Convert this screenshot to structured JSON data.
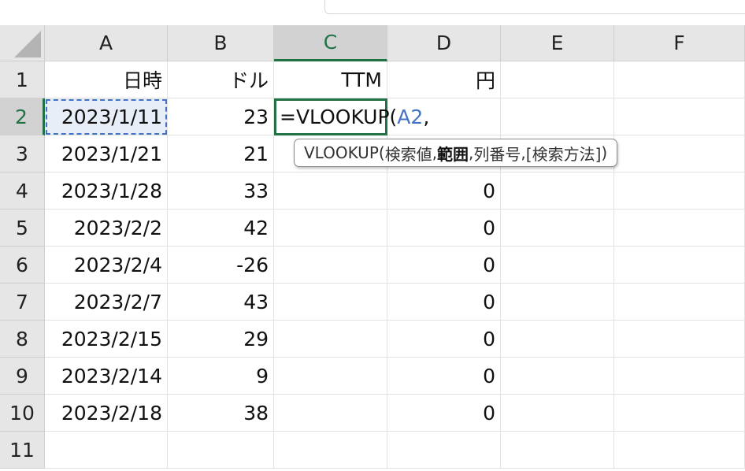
{
  "columns": [
    "A",
    "B",
    "C",
    "D",
    "E",
    "F"
  ],
  "rows": [
    "1",
    "2",
    "3",
    "4",
    "5",
    "6",
    "7",
    "8",
    "9",
    "10",
    "11"
  ],
  "headers": {
    "A": "日時",
    "B": "ドル",
    "C": "TTM",
    "D": "円"
  },
  "data": [
    {
      "A": "2023/1/11",
      "B": "23",
      "D": ""
    },
    {
      "A": "2023/1/21",
      "B": "21",
      "D": ""
    },
    {
      "A": "2023/1/28",
      "B": "33",
      "D": "0"
    },
    {
      "A": "2023/2/2",
      "B": "42",
      "D": "0"
    },
    {
      "A": "2023/2/4",
      "B": "-26",
      "D": "0"
    },
    {
      "A": "2023/2/7",
      "B": "43",
      "D": "0"
    },
    {
      "A": "2023/2/15",
      "B": "29",
      "D": "0"
    },
    {
      "A": "2023/2/14",
      "B": "9",
      "D": "0"
    },
    {
      "A": "2023/2/18",
      "B": "38",
      "D": "0"
    }
  ],
  "editing": {
    "formula_prefix": "=VLOOKUP(",
    "formula_ref": "A2",
    "formula_suffix": ","
  },
  "tooltip": {
    "func": "VLOOKUP(",
    "arg1": "検索値",
    "sep1": ", ",
    "arg2": "範囲",
    "sep2": ", ",
    "arg3": "列番号",
    "sep3": ", ",
    "arg4": "[検索方法]",
    "close": ")"
  },
  "colors": {
    "accent": "#217346",
    "reference": "#4472c4"
  }
}
